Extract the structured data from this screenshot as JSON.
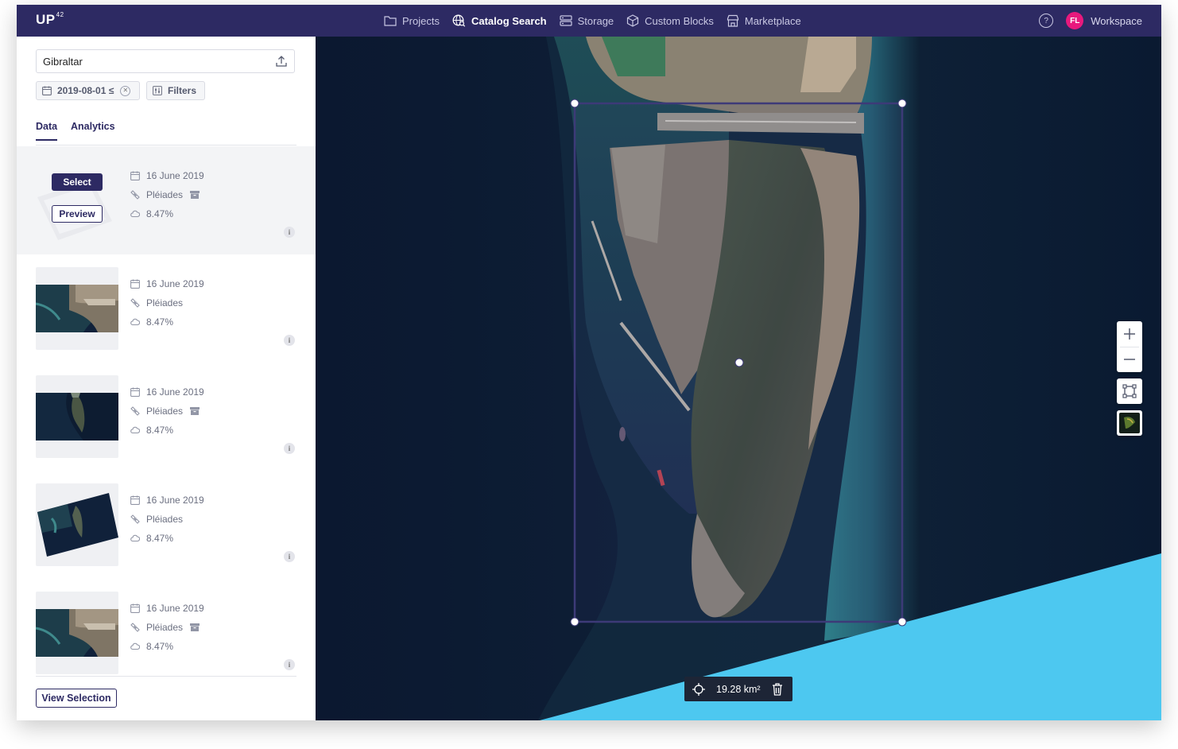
{
  "app": {
    "logo": "UP",
    "logo_sup": "42"
  },
  "nav": {
    "items": [
      {
        "label": "Projects",
        "icon": "folder-icon",
        "active": false
      },
      {
        "label": "Catalog Search",
        "icon": "globe-search-icon",
        "active": true
      },
      {
        "label": "Storage",
        "icon": "storage-icon",
        "active": false
      },
      {
        "label": "Custom Blocks",
        "icon": "cube-icon",
        "active": false
      },
      {
        "label": "Marketplace",
        "icon": "store-icon",
        "active": false
      }
    ],
    "help_label": "?",
    "avatar_initials": "FL",
    "workspace_label": "Workspace",
    "avatar_color": "#e8197d",
    "bar_color": "#2d2a63"
  },
  "sidebar": {
    "search_value": "Gibraltar",
    "date_chip": "2019-08-01 ≤",
    "filters_chip": "Filters",
    "tabs": [
      {
        "label": "Data",
        "active": true
      },
      {
        "label": "Analytics",
        "active": false
      }
    ],
    "select_label": "Select",
    "preview_label": "Preview",
    "results": [
      {
        "date": "16 June 2019",
        "sensor": "Pléiades",
        "cloud": "8.47%",
        "archived": true,
        "info": "i",
        "thumb": "blank"
      },
      {
        "date": "16 June 2019",
        "sensor": "Pléiades",
        "cloud": "8.47%",
        "archived": false,
        "info": "i",
        "thumb": "harbor"
      },
      {
        "date": "16 June 2019",
        "sensor": "Pléiades",
        "cloud": "8.47%",
        "archived": true,
        "info": "i",
        "thumb": "peninsula"
      },
      {
        "date": "16 June 2019",
        "sensor": "Pléiades",
        "cloud": "8.47%",
        "archived": false,
        "info": "i",
        "thumb": "tilted"
      },
      {
        "date": "16 June 2019",
        "sensor": "Pléiades",
        "cloud": "8.47%",
        "archived": true,
        "info": "i",
        "thumb": "harbor"
      }
    ],
    "view_selection_label": "View Selection"
  },
  "map": {
    "aoi_area": "19.28 km²",
    "zoom_in": "+",
    "zoom_out": "−",
    "aoi_color": "#3d3a78",
    "coverage_color": "#4dc8f0"
  }
}
